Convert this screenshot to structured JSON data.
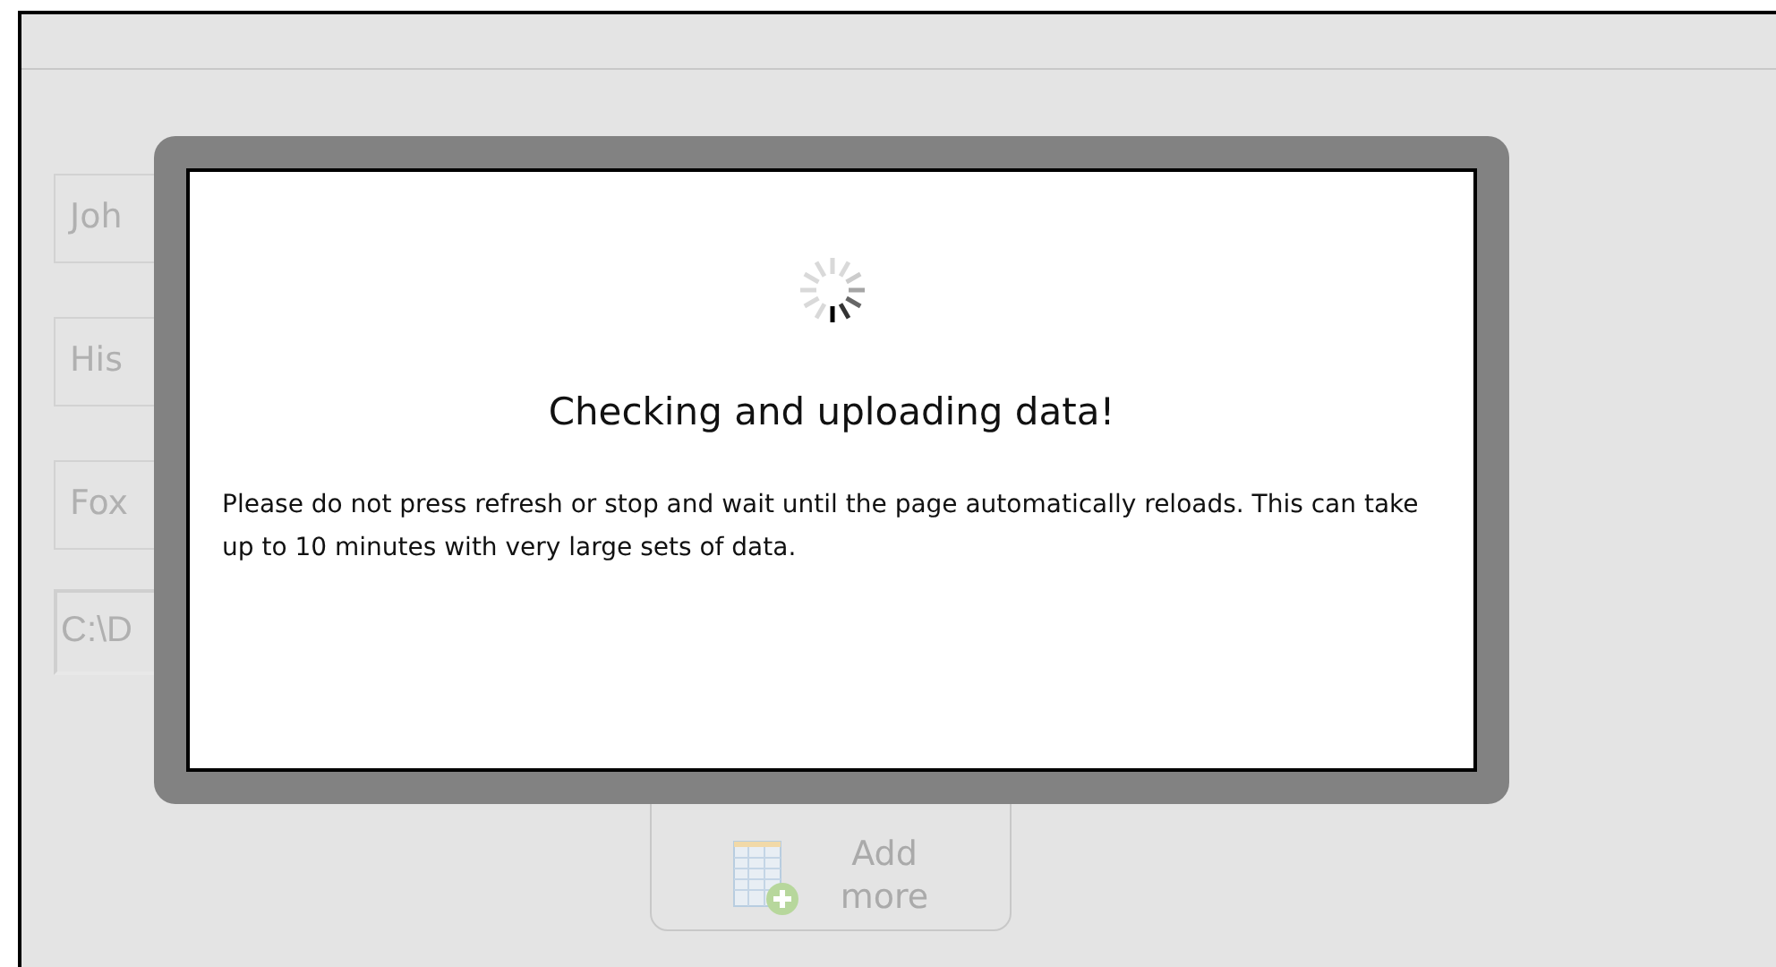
{
  "form": {
    "fields": [
      {
        "kind": "text",
        "value": "Joh"
      },
      {
        "kind": "text",
        "value": "His"
      },
      {
        "kind": "text",
        "value": "Fox"
      },
      {
        "kind": "file",
        "value": "C:\\D"
      }
    ],
    "add_button": {
      "label_lines": [
        "Add",
        "more"
      ]
    }
  },
  "modal": {
    "title": "Checking and uploading data!",
    "message": "Please do not press refresh or stop and wait until the page automatically reloads. This can take up to 10 minutes with very large sets of data."
  }
}
